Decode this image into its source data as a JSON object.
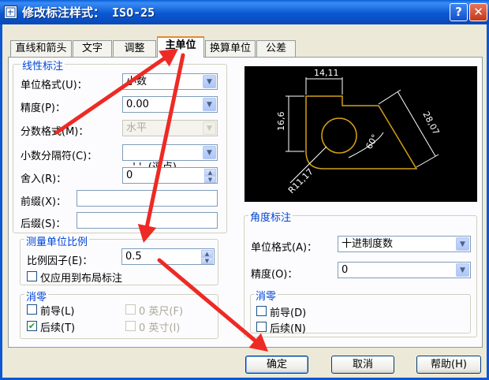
{
  "window": {
    "title": "修改标注样式： ISO-25",
    "help_glyph": "?",
    "close_glyph": "✕"
  },
  "tabs": [
    {
      "label": "直线和箭头",
      "active": false
    },
    {
      "label": "文字",
      "active": false
    },
    {
      "label": "调整",
      "active": false
    },
    {
      "label": "主单位",
      "active": true
    },
    {
      "label": "换算单位",
      "active": false
    },
    {
      "label": "公差",
      "active": false
    }
  ],
  "linear": {
    "title": "线性标注",
    "unit_format": {
      "label": "单位格式(U)：",
      "value": "小数"
    },
    "precision": {
      "label": "精度(P)：",
      "value": "0.00"
    },
    "fraction_format": {
      "label": "分数格式(M)：",
      "value": "水平",
      "disabled": true
    },
    "decimal_separator": {
      "label": "小数分隔符(C)：",
      "value": "','  (逗点)"
    },
    "round_off": {
      "label": "舍入(R)：",
      "value": "0"
    },
    "prefix": {
      "label": "前缀(X)：",
      "value": ""
    },
    "suffix": {
      "label": "后缀(S)：",
      "value": ""
    }
  },
  "scale": {
    "title": "测量单位比例",
    "factor": {
      "label": "比例因子(E)：",
      "value": "0.5"
    },
    "layout_only": {
      "label": "仅应用到布局标注",
      "checked": false
    }
  },
  "zero_suppress": {
    "title": "消零",
    "leading": {
      "label": "前导(L)",
      "checked": false
    },
    "trailing": {
      "label": "后续(T)",
      "checked": true
    },
    "feet": {
      "label": "0 英尺(F)",
      "checked": false,
      "disabled": true
    },
    "inches": {
      "label": "0 英寸(I)",
      "checked": false,
      "disabled": true
    }
  },
  "preview": {
    "dims": [
      "14,11",
      "16,6",
      "28,07",
      "60°",
      "R11,17"
    ],
    "line_color": "#d4a017"
  },
  "angular": {
    "title": "角度标注",
    "unit_format": {
      "label": "单位格式(A)：",
      "value": "十进制度数"
    },
    "precision": {
      "label": "精度(O)：",
      "value": "0"
    },
    "zero_title": "消零",
    "leading": {
      "label": "前导(D)",
      "checked": false
    },
    "trailing": {
      "label": "后续(N)",
      "checked": false
    }
  },
  "buttons": {
    "ok": "确定",
    "cancel": "取消",
    "help": "帮助(H)"
  },
  "annotations": {
    "arrow_color": "#ee2a24"
  }
}
